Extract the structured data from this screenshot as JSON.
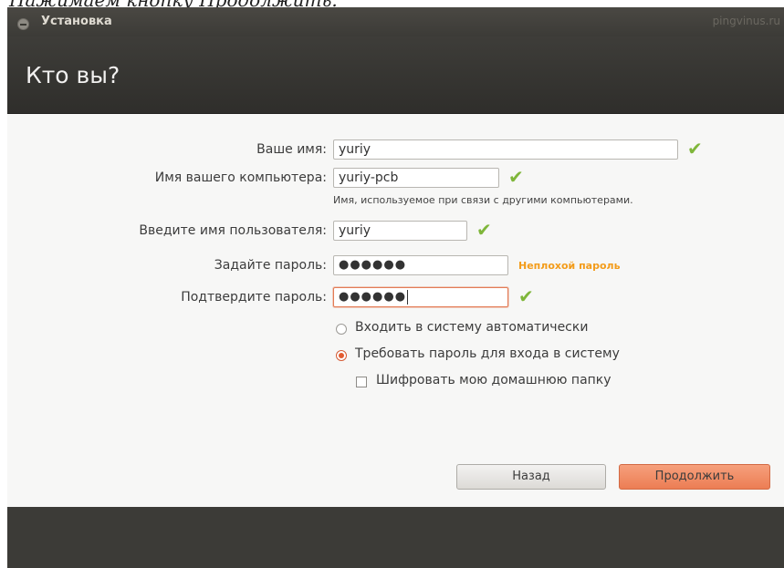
{
  "caption": "Нажимаем кнопку Продолжить.",
  "window": {
    "title": "Установка",
    "watermark": "pingvinus.ru",
    "page_title": "Кто вы?"
  },
  "form": {
    "name_label": "Ваше имя:",
    "name_value": "yuriy",
    "computer_label": "Имя вашего компьютера:",
    "computer_value": "yuriy-pcb",
    "computer_hint": "Имя, используемое при связи с другими компьютерами.",
    "username_label": "Введите имя пользователя:",
    "username_value": "yuriy",
    "password_label": "Задайте пароль:",
    "password_value": "●●●●●●",
    "password_strength": "Неплохой пароль",
    "confirm_label": "Подтвердите пароль:",
    "confirm_value": "●●●●●●"
  },
  "login_options": {
    "auto_label": "Входить в систему автоматически",
    "require_label": "Требовать пароль для входа в систему",
    "selected": "require",
    "encrypt_label": "Шифровать мою домашнюю папку",
    "encrypt_checked": false
  },
  "buttons": {
    "back_label": "Назад",
    "continue_label": "Продолжить"
  },
  "colors": {
    "accent": "#ec7d54",
    "valid_check": "#7fb63a",
    "strength_text": "#f39c1a",
    "header_bg": "#3c3b37"
  }
}
